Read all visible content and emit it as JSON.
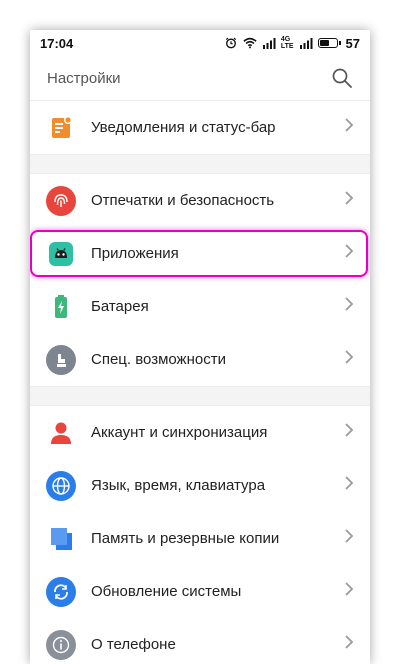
{
  "status_bar": {
    "time": "17:04",
    "network_label_top": "4G",
    "network_label_bottom": "LTE",
    "battery": "57",
    "battery_level_percent": 57
  },
  "header": {
    "title": "Настройки",
    "search_icon": "search-icon"
  },
  "sections": [
    {
      "items": [
        {
          "label": "Уведомления и статус-бар",
          "icon": "notifications-icon",
          "color": "#f28c2c"
        }
      ]
    },
    {
      "items": [
        {
          "label": "Отпечатки и безопасность",
          "icon": "fingerprint-icon",
          "color": "#e8453c"
        },
        {
          "label": "Приложения",
          "icon": "android-icon",
          "color": "#2fbfa3",
          "highlighted": true
        },
        {
          "label": "Батарея",
          "icon": "battery-icon",
          "color": "#3cb878"
        },
        {
          "label": "Спец. возможности",
          "icon": "accessibility-icon",
          "color": "#7d8590"
        }
      ]
    },
    {
      "items": [
        {
          "label": "Аккаунт и синхронизация",
          "icon": "account-icon",
          "color": "#e8453c"
        },
        {
          "label": "Язык, время, клавиатура",
          "icon": "globe-icon",
          "color": "#2b7de9"
        },
        {
          "label": "Память и резервные копии",
          "icon": "storage-icon",
          "color": "#2b7de9"
        },
        {
          "label": "Обновление системы",
          "icon": "update-icon",
          "color": "#2b7de9"
        },
        {
          "label": "О телефоне",
          "icon": "info-icon",
          "color": "#8a9099"
        }
      ]
    }
  ],
  "colors": {
    "highlight": "#e400c6",
    "section_gap": "#f4f4f4",
    "chevron": "#9a9a9a"
  }
}
